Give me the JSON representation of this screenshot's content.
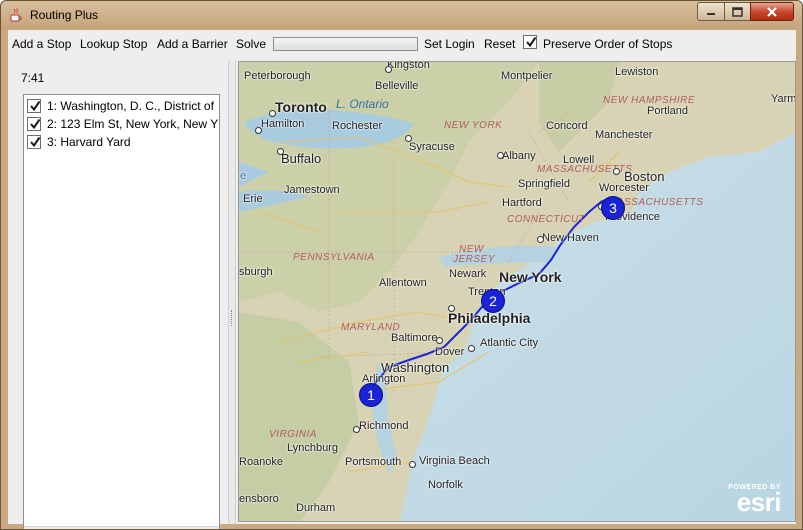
{
  "window": {
    "title": "Routing Plus"
  },
  "toolbar": {
    "add_stop": "Add a Stop",
    "lookup_stop": "Lookup Stop",
    "add_barrier": "Add a Barrier",
    "solve": "Solve",
    "set_login": "Set Login",
    "reset": "Reset",
    "preserve_order": "Preserve Order of Stops",
    "preserve_order_checked": true
  },
  "panel": {
    "time": "7:41",
    "stops": [
      {
        "label": "1: Washington, D. C., District of",
        "checked": true
      },
      {
        "label": "2: 123 Elm St, New York, New Y",
        "checked": true
      },
      {
        "label": "3: Harvard Yard",
        "checked": true
      }
    ]
  },
  "map": {
    "labels": {
      "kingston": "Kingston",
      "peterborough": "Peterborough",
      "belleville": "Belleville",
      "montpelier": "Montpelier",
      "lewiston": "Lewiston",
      "toronto": "Toronto",
      "lake_ontario": "L. Ontario",
      "hamilton": "Hamilton",
      "rochester": "Rochester",
      "new_york_state": "NEW YORK",
      "new_hampshire": "NEW HAMPSHIRE",
      "portland": "Portland",
      "yarm": "Yarm",
      "concord": "Concord",
      "manchester": "Manchester",
      "buffalo": "Buffalo",
      "syracuse": "Syracuse",
      "albany": "Albany",
      "lowell": "Lowell",
      "massachusetts_1": "MASSACHUSETTS",
      "boston": "Boston",
      "springfield": "Springfield",
      "worcester": "Worcester",
      "jamestown": "Jamestown",
      "erie": "Erie",
      "hartford": "Hartford",
      "massachusetts_2": "MASSACHUSETTS",
      "providence": "Providence",
      "connecticut": "CONNECTICUT",
      "new_haven": "New Haven",
      "pennsylvania": "PENNSYLVANIA",
      "new_jersey_1": "NEW",
      "new_jersey_2": "JERSEY",
      "pittsburgh": "sburgh",
      "newark": "Newark",
      "new_york": "New York",
      "allentown": "Allentown",
      "trenton": "Trenton",
      "philadelphia": "Philadelphia",
      "maryland": "MARYLAND",
      "baltimore": "Baltimore",
      "dover": "Dover",
      "atlantic_city": "Atlantic City",
      "washington": "Washington",
      "arlington": "Arlington",
      "virginia": "VIRGINIA",
      "richmond": "Richmond",
      "lynchburg": "Lynchburg",
      "roanoke": "Roanoke",
      "portsmouth": "Portsmouth",
      "virginia_beach": "Virginia Beach",
      "norfolk": "Norfolk",
      "greensboro": "ensboro",
      "durham": "Durham",
      "e_tag": "e"
    },
    "markers": [
      "1",
      "2",
      "3"
    ],
    "route_color": "#1a24d6",
    "attribution_powered": "POWERED BY",
    "attribution_logo": "esri"
  }
}
